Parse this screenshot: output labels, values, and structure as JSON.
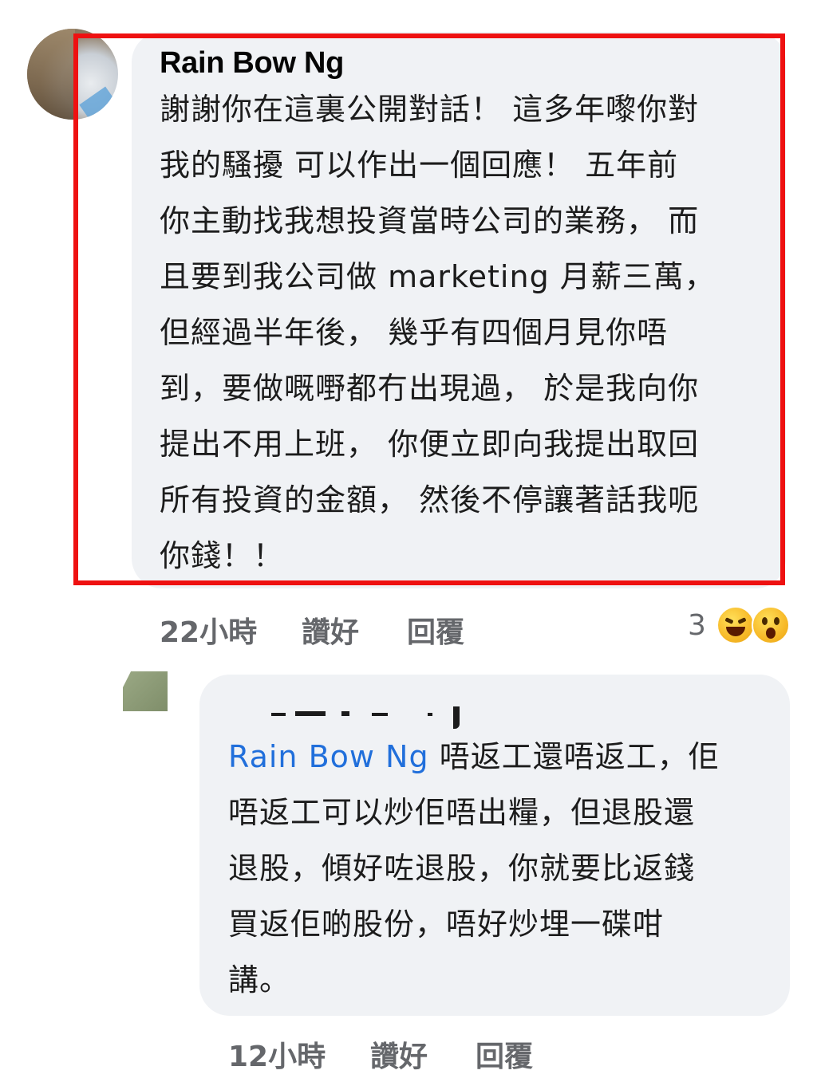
{
  "comment": {
    "author": "Rain Bow Ng",
    "lines": [
      "謝謝你在這裏公開對話！ 這多年嚟你對",
      "我的騷擾 可以作出一個回應！ 五年前",
      "你主動找我想投資當時公司的業務， 而",
      "且要到我公司做 marketing 月薪三萬，",
      "但經過半年後， 幾乎有四個月見你唔",
      "到，要做嘅嘢都冇出現過， 於是我向你",
      "提出不用上班， 你便立即向我提出取回",
      "所有投資的金額， 然後不停讓著話我呃",
      "你錢！！"
    ],
    "time": "22小時",
    "like_label": "讚好",
    "reply_label": "回覆",
    "reaction_count": "3",
    "reactions": [
      "haha-emoji-icon",
      "wow-emoji-icon"
    ],
    "highlight_color": "#ee1111"
  },
  "reply": {
    "mention": "Rain Bow Ng",
    "first_line_rest": " 唔返工還唔返工，佢",
    "lines": [
      "唔返工可以炒佢唔出糧，但退股還",
      "退股，傾好咗退股，你就要比返錢",
      "買返佢啲股份，唔好炒埋一碟咁",
      "講。"
    ],
    "time": "12小時",
    "like_label": "讚好",
    "reply_label": "回覆",
    "mention_color": "#216fdb"
  }
}
